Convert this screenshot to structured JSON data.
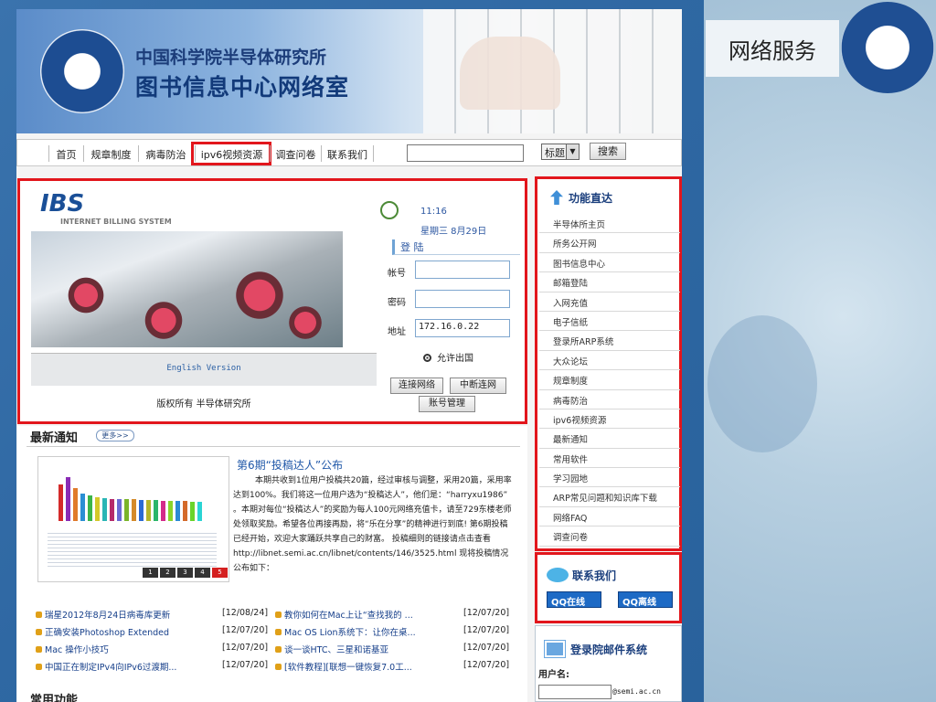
{
  "slide": {
    "title": "网络服务"
  },
  "banner": {
    "org": "中国科学院半导体研究所",
    "dept": "图书信息中心网络室"
  },
  "nav": {
    "items": [
      "首页",
      "规章制度",
      "病毒防治",
      "ipv6视频资源",
      "调查问卷",
      "联系我们"
    ],
    "search_select": "标题",
    "search_button": "搜索"
  },
  "ibs": {
    "logo": "IBS",
    "logo_sub": "INTERNET BILLING SYSTEM",
    "time": "11:16",
    "date": "星期三 8月29日",
    "login_title": "登 陆",
    "account_label": "帐号",
    "password_label": "密码",
    "address_label": "地址",
    "address_value": "172.16.0.22",
    "allow_abroad": "允许出国",
    "english_version": "English Version",
    "copyright": "版权所有 半导体研究所",
    "btn_connect": "连接网络",
    "btn_disconnect": "中断连网",
    "btn_account": "账号管理"
  },
  "news": {
    "heading": "最新通知",
    "more": "更多>>",
    "post_title": "第6期“投稿达人”公布",
    "post_body": "本期共收到1位用户投稿共20篇，经过审核与调整，采用20篇，采用率达到100%。我们将这一位用户选为“投稿达人”，他们是：“harryxu1986” 。本期对每位“投稿达人”的奖励为每人100元网络充值卡，请至729东楼老师处领取奖励。希望各位再接再励，将“乐在分享”的精神进行到底! 第6期投稿已经开始，欢迎大家踊跃共享自己的财富。 投稿细则的链接请点击查看 http://libnet.semi.ac.cn/libnet/contents/146/3525.html 现将投稿情况公布如下：",
    "pages": [
      "1",
      "2",
      "3",
      "4",
      "5"
    ],
    "left_items": [
      {
        "title": "瑞星2012年8月24日病毒库更新",
        "date": "[12/08/24]"
      },
      {
        "title": "正确安装Photoshop Extended",
        "date": "[12/07/20]"
      },
      {
        "title": "Mac 操作小技巧",
        "date": "[12/07/20]"
      },
      {
        "title": "中国正在制定IPv4向IPv6过渡期...",
        "date": "[12/07/20]"
      }
    ],
    "right_items": [
      {
        "title": "教你如何在Mac上让“查找我的 ...",
        "date": "[12/07/20]"
      },
      {
        "title": "Mac OS Lion系统下：让你在桌...",
        "date": "[12/07/20]"
      },
      {
        "title": "谈一谈HTC、三星和诺基亚",
        "date": "[12/07/20]"
      },
      {
        "title": "[软件教程][联想一键恢复7.0工...",
        "date": "[12/07/20]"
      }
    ],
    "common_heading": "常用功能"
  },
  "sidebar": {
    "heading": "功能直达",
    "items": [
      "半导体所主页",
      "所务公开网",
      "图书信息中心",
      "邮箱登陆",
      "入网充值",
      "电子信纸",
      "登录所ARP系统",
      "大众论坛",
      "规章制度",
      "病毒防治",
      "ipv6视频资源",
      "最新通知",
      "常用软件",
      "学习园地",
      "ARP常见问题和知识库下载",
      "网络FAQ",
      "调查问卷"
    ]
  },
  "contact": {
    "heading": "联系我们",
    "qq_online": "QQ在线",
    "qq_offline": "QQ离线"
  },
  "mail": {
    "heading": "登录院邮件系统",
    "username_label": "用户名:",
    "domain": "@semi.ac.cn"
  }
}
